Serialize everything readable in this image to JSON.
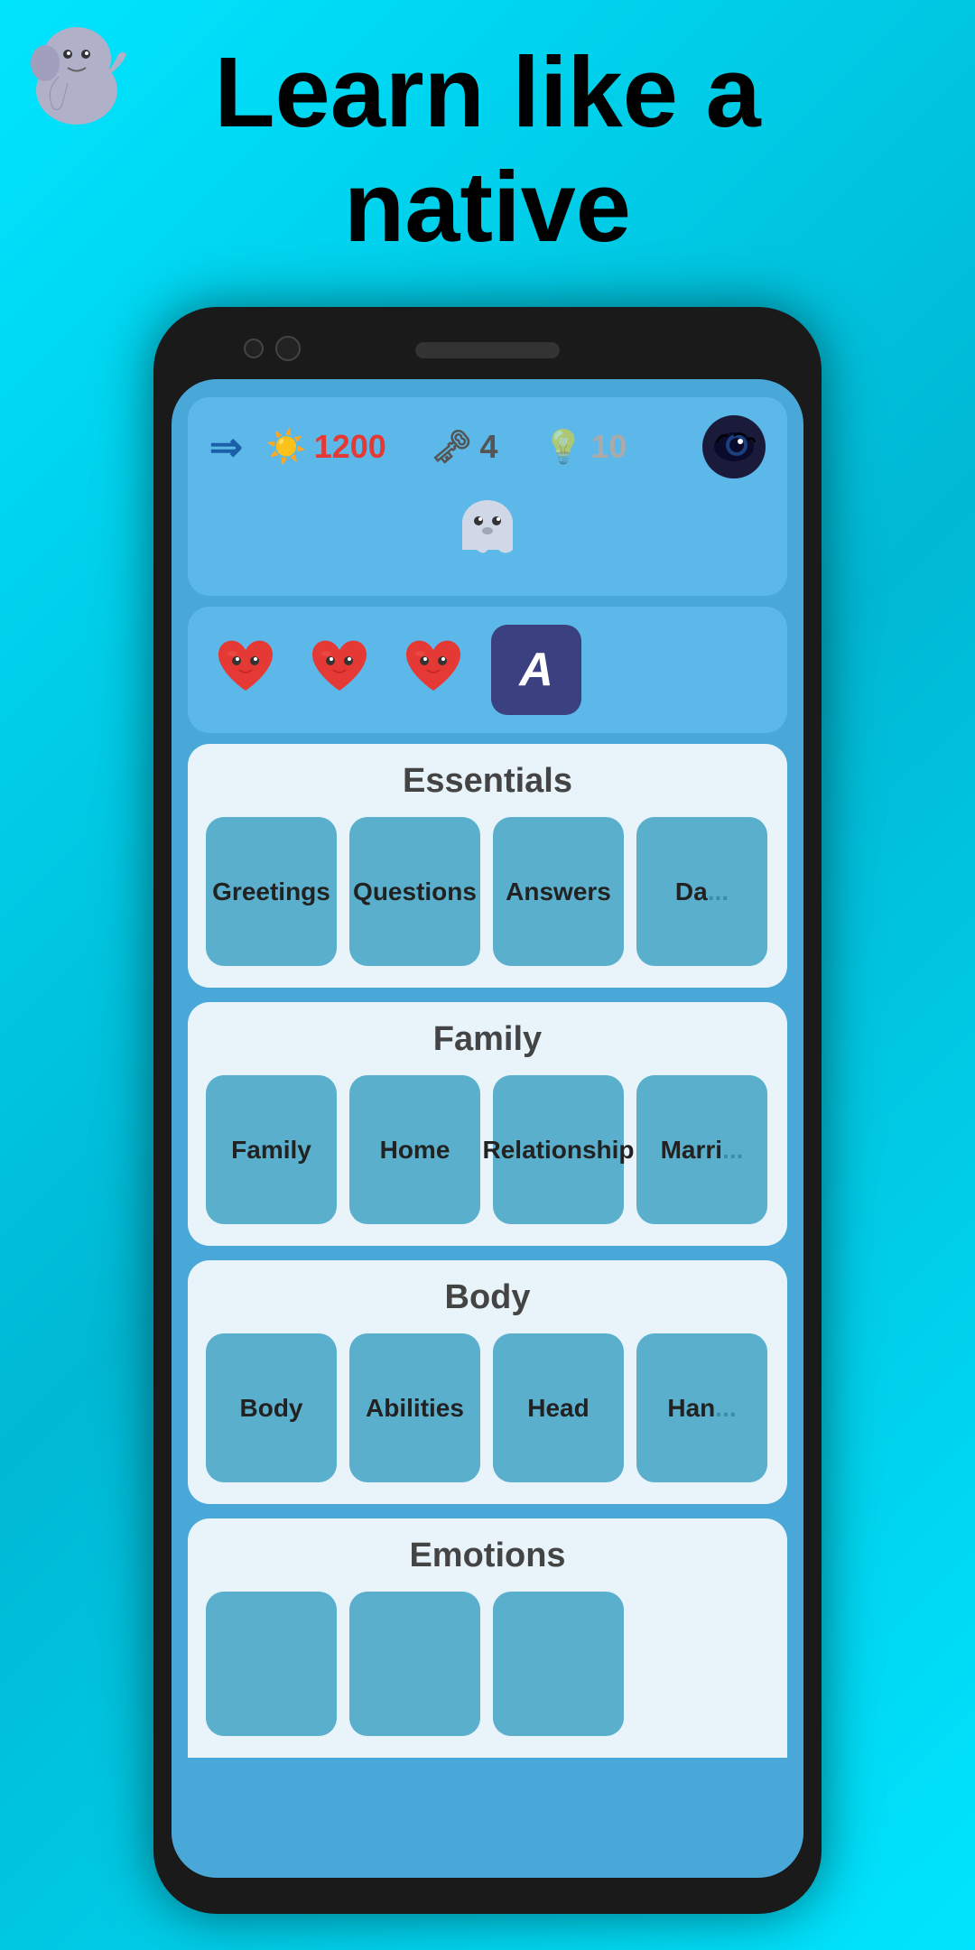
{
  "page": {
    "title_line1": "Learn like a",
    "title_line2": "native"
  },
  "header": {
    "stats": {
      "sun_count": "1200",
      "key_count": "4",
      "hint_count": "10"
    }
  },
  "lives": {
    "count": 3
  },
  "sections": [
    {
      "id": "essentials",
      "title": "Essentials",
      "items": [
        "Greetings",
        "Questions",
        "Answers",
        "Da..."
      ]
    },
    {
      "id": "family",
      "title": "Family",
      "items": [
        "Family",
        "Home",
        "Relationship",
        "Marri..."
      ]
    },
    {
      "id": "body",
      "title": "Body",
      "items": [
        "Body",
        "Abilities",
        "Head",
        "Han..."
      ]
    },
    {
      "id": "emotions",
      "title": "Emotions",
      "items": [
        "",
        "",
        ""
      ]
    }
  ],
  "icons": {
    "arrows": "⇒",
    "sun": "☀️",
    "key": "🗝",
    "hint": "💡",
    "eye": "👁",
    "mascot_emoji": "👻",
    "vocab_letter": "A"
  }
}
